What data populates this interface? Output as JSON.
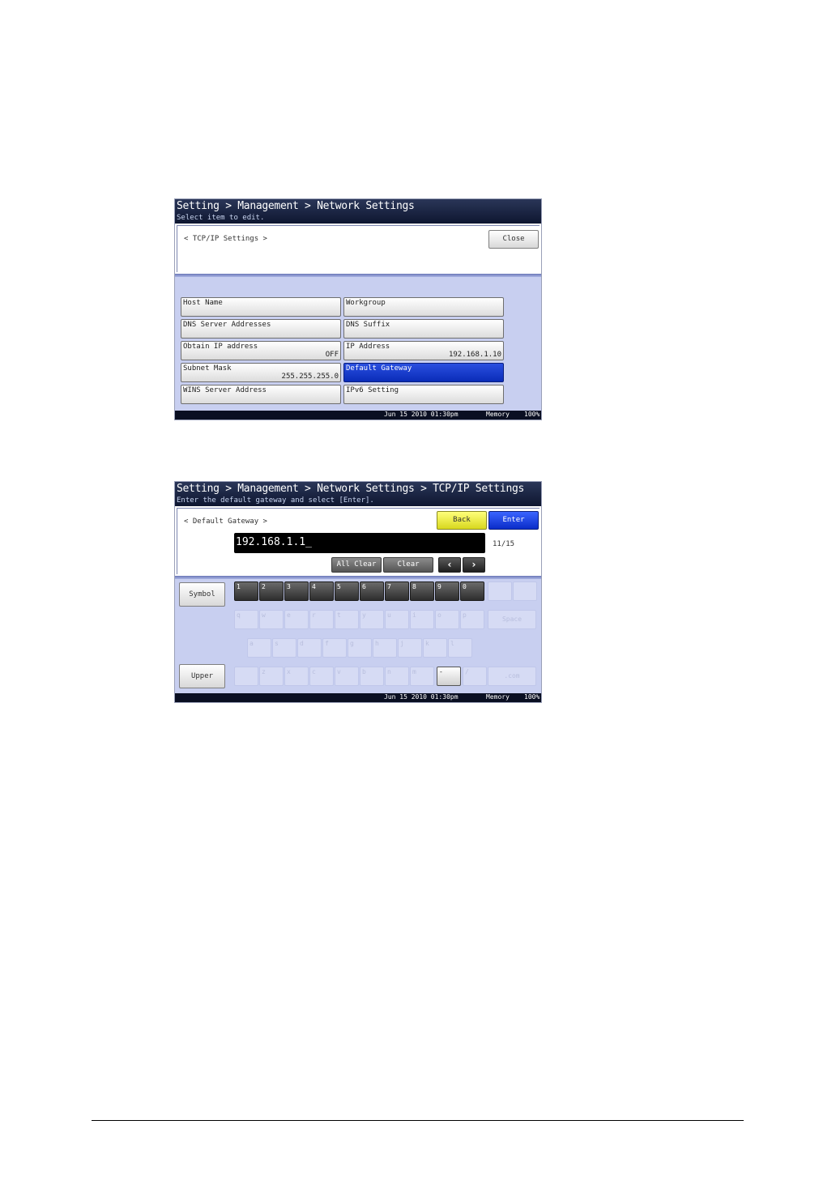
{
  "screen1": {
    "breadcrumb": "Setting > Management > Network Settings",
    "subtitle": "Select item to edit.",
    "path": "< TCP/IP Settings >",
    "close_label": "Close",
    "items": [
      {
        "label": "Host Name",
        "value": ""
      },
      {
        "label": "Workgroup",
        "value": ""
      },
      {
        "label": "DNS Server Addresses",
        "value": ""
      },
      {
        "label": "DNS Suffix",
        "value": ""
      },
      {
        "label": "Obtain IP address",
        "value": "OFF"
      },
      {
        "label": "IP Address",
        "value": "192.168.1.10"
      },
      {
        "label": "Subnet Mask",
        "value": "255.255.255.0"
      },
      {
        "label": "Default Gateway",
        "value": ""
      },
      {
        "label": "WINS Server Address",
        "value": ""
      },
      {
        "label": "IPv6 Setting",
        "value": ""
      }
    ],
    "footer": {
      "datetime": "Jun 15 2010 01:30pm",
      "memory_label": "Memory",
      "memory_value": "100%"
    }
  },
  "screen2": {
    "breadcrumb": "Setting > Management > Network Settings > TCP/IP Settings",
    "subtitle": "Enter the default gateway and select [Enter].",
    "path": "< Default Gateway >",
    "back_label": "Back",
    "enter_label": "Enter",
    "input_value": "192.168.1.1_",
    "counter": "11/15",
    "all_clear_label": "All Clear",
    "clear_label": "Clear",
    "symbol_label": "Symbol",
    "upper_label": "Upper",
    "row1": [
      "1",
      "2",
      "3",
      "4",
      "5",
      "6",
      "7",
      "8",
      "9",
      "0",
      "",
      ""
    ],
    "row2": [
      "q",
      "w",
      "e",
      "r",
      "t",
      "y",
      "u",
      "i",
      "o",
      "p"
    ],
    "space_label": "Space",
    "row3": [
      "a",
      "s",
      "d",
      "f",
      "g",
      "h",
      "j",
      "k",
      "l"
    ],
    "row4": [
      "",
      "z",
      "x",
      "c",
      "v",
      "b",
      "n",
      "m",
      "-",
      "/"
    ],
    "dotcom_label": ".com",
    "footer": {
      "datetime": "Jun 15 2010 01:30pm",
      "memory_label": "Memory",
      "memory_value": "100%"
    }
  },
  "colors": {
    "header": "#0e1630",
    "selected": "#0a2cb8",
    "back": "#e8e82a",
    "enter": "#0a2cd8",
    "lower_bg": "#c8cff0"
  }
}
